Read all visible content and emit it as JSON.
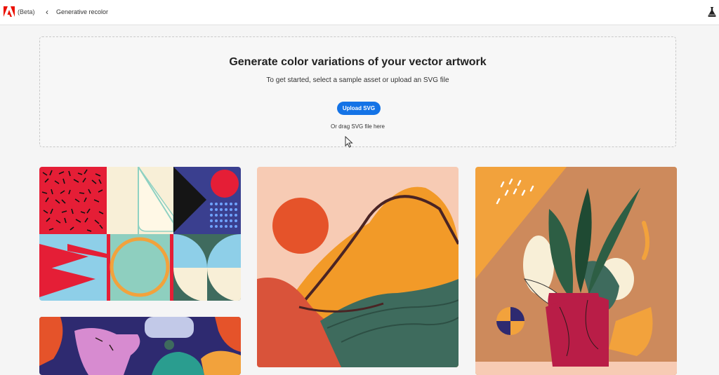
{
  "header": {
    "logo_icon": "adobe-logo",
    "beta_label": "(Beta)",
    "back_icon": "chevron-left-icon",
    "breadcrumb": "Generative recolor",
    "lab_icon": "flask-icon"
  },
  "dropzone": {
    "title": "Generate color variations of your vector artwork",
    "subtitle": "To get started, select a sample asset or upload an SVG file",
    "upload_label": "Upload SVG",
    "drag_hint": "Or drag SVG file here"
  },
  "samples": [
    {
      "name": "Geometric pattern tiles"
    },
    {
      "name": "Abstract landscape"
    },
    {
      "name": "Plant in vase"
    },
    {
      "name": "Figures illustration"
    }
  ],
  "colors": {
    "accent": "#1473e6",
    "brand": "#eb1000"
  }
}
